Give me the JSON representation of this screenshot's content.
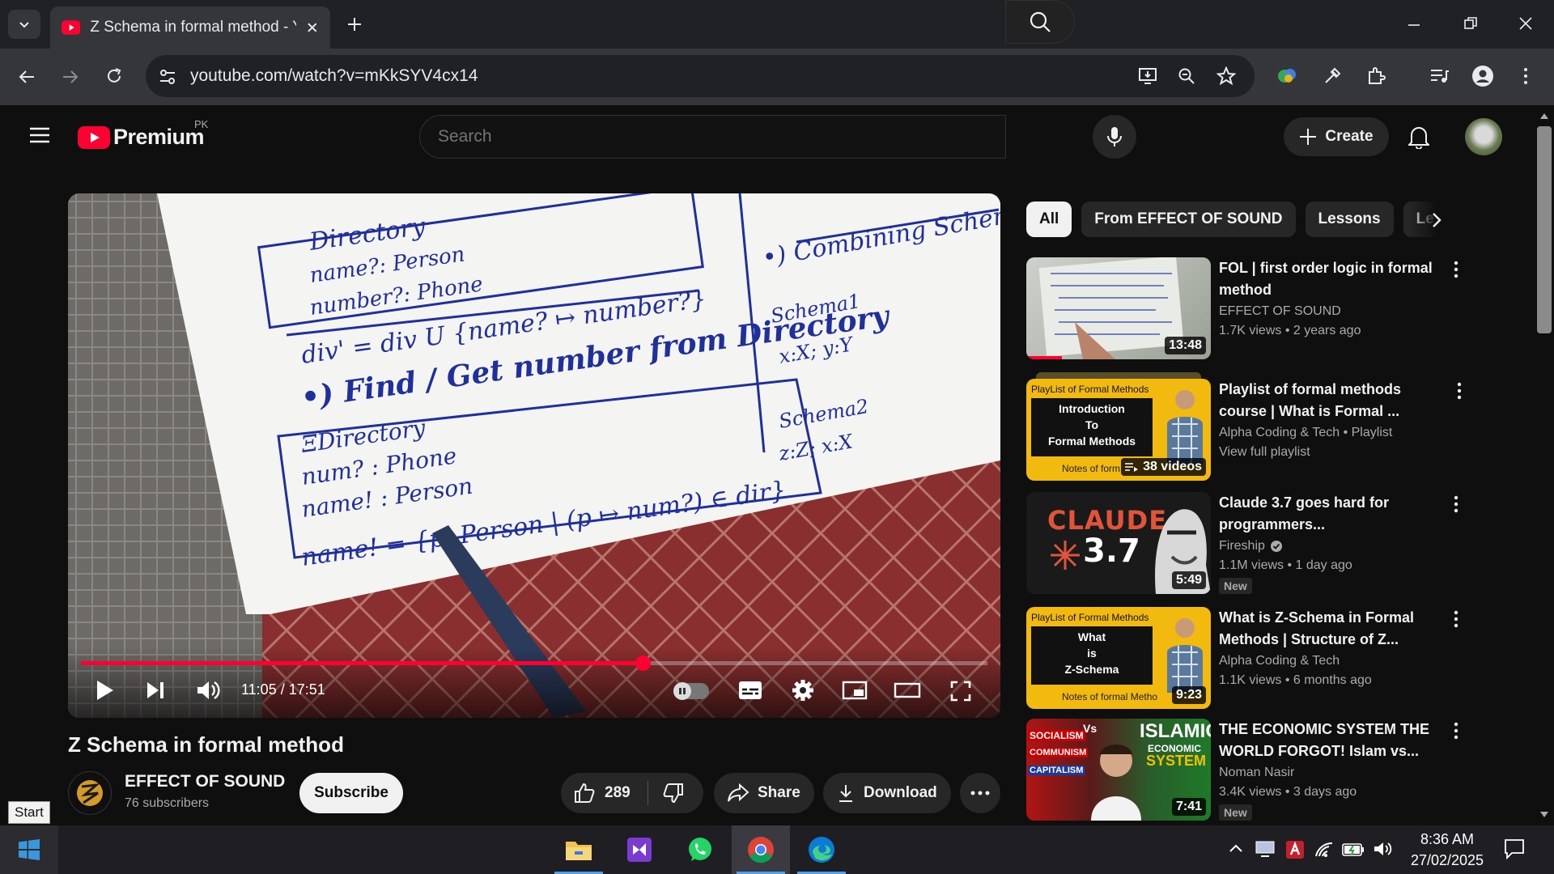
{
  "browser": {
    "tab_title": "Z Schema in formal method - Yo",
    "url": "youtube.com/watch?v=mKkSYV4cx14"
  },
  "yt": {
    "logo_text": "Premium",
    "region": "PK",
    "search_placeholder": "Search",
    "create_label": "Create"
  },
  "player": {
    "time": "11:05 / 17:51",
    "progress": 0.62
  },
  "video": {
    "title": "Z Schema in formal method",
    "channel": "EFFECT OF SOUND",
    "subscribers": "76 subscribers",
    "subscribe_label": "Subscribe",
    "likes": "289",
    "share_label": "Share",
    "download_label": "Download"
  },
  "chips": [
    "All",
    "From EFFECT OF SOUND",
    "Lessons",
    "Le"
  ],
  "recommendations": [
    {
      "title": "FOL | first order logic in formal method",
      "channel": "EFFECT OF SOUND",
      "meta": "1.7K views  • 2 years ago",
      "duration": "13:48"
    },
    {
      "title": "Playlist of formal methods course | What is Formal ...",
      "channel": "Alpha Coding & Tech • Playlist",
      "meta": "View full playlist",
      "duration": "38 videos",
      "thumb_lines": [
        "PlayList of Formal Methods",
        "Introduction",
        "To",
        "Formal Methods",
        "Notes of form"
      ]
    },
    {
      "title": "Claude 3.7 goes hard for programmers...",
      "channel": "Fireship",
      "meta": "1.1M views  • 1 day ago",
      "badge": "New",
      "duration": "5:49",
      "thumb_lines": [
        "CLAUDE",
        "3.7"
      ]
    },
    {
      "title": "What is Z-Schema in Formal Methods | Structure of Z...",
      "channel": "Alpha Coding & Tech",
      "meta": "1.1K views  • 6 months ago",
      "duration": "9:23",
      "thumb_lines": [
        "PlayList of Formal Methods",
        "What",
        "is",
        "Z-Schema",
        "Notes of formal Metho"
      ]
    },
    {
      "title": "THE ECONOMIC SYSTEM THE WORLD FORGOT! Islam vs...",
      "channel": "Noman Nasir",
      "meta": "3.4K views  • 3 days ago",
      "badge": "New",
      "duration": "7:41",
      "thumb_lines": [
        "SOCIALISM",
        "Vs",
        "ISLAMIC",
        "ECONOMIC",
        "SYSTEM",
        "COMMUNISM",
        "CAPITALISM"
      ]
    }
  ],
  "taskbar": {
    "start_tooltip": "Start",
    "time": "8:36 AM",
    "date": "27/02/2025"
  }
}
